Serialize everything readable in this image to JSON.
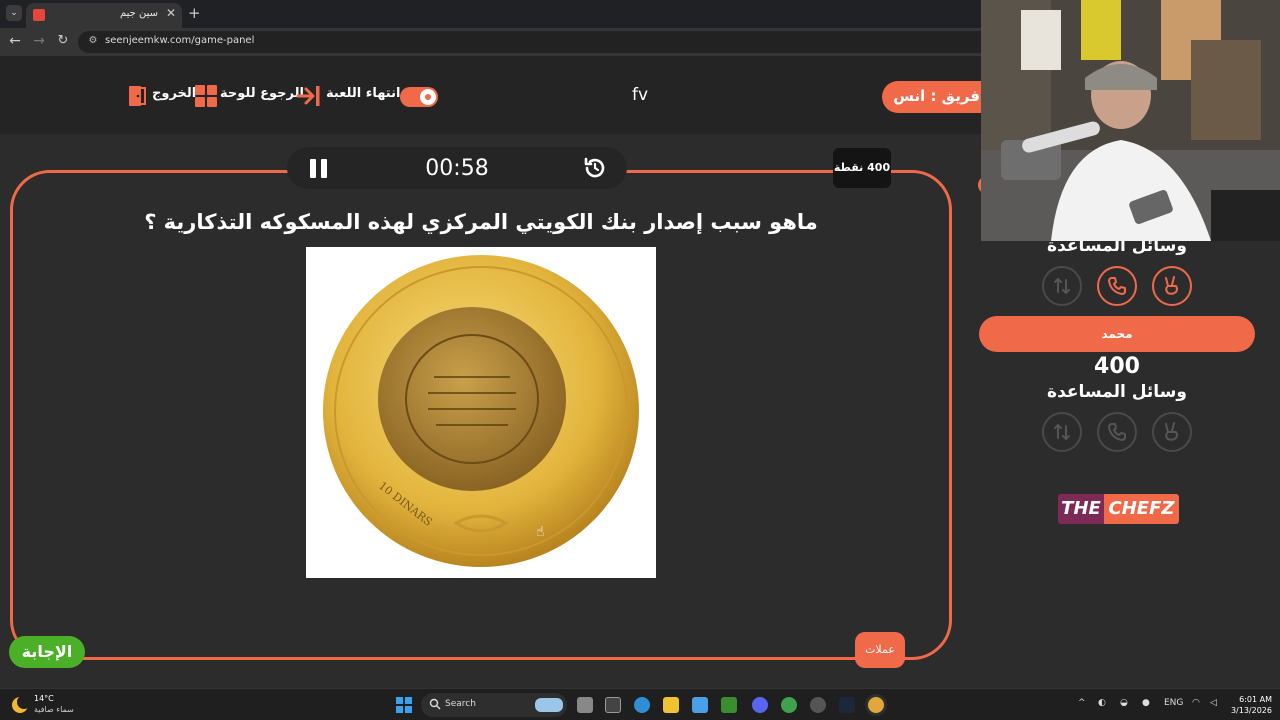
{
  "browser": {
    "tab_title": "سين جيم",
    "tab_close": "✕",
    "new_tab": "+",
    "url": "seenjeemkw.com/game-panel"
  },
  "header": {
    "exit_label": "الخروج",
    "board_label": "الرجوع للوحة",
    "end_game_label": "انتهاء اللعبة",
    "brand": "fv",
    "team_label": "فريق : انس"
  },
  "question_panel": {
    "timer": "00:58",
    "points": "400 نقطة",
    "question": "ماهو سبب إصدار بنك الكويتي المركزي لهذه المسكوكه التذكارية ؟",
    "image_alt": "gold commemorative coin 10 DINARS",
    "coin_text": "10 DINARS",
    "category": "عملات",
    "answer_button": "الإجابة"
  },
  "right_panel": {
    "aids_title_1": "وسائل المساعدة",
    "team_2_name": "محمد",
    "team_2_score": "400",
    "aids_title_2": "وسائل المساعدة",
    "sponsor_the": "THE",
    "sponsor_name": "CHEFZ"
  },
  "taskbar": {
    "temperature": "14°C",
    "weather": "سماء صافية",
    "search_placeholder": "Search",
    "language": "ENG",
    "time": "6:01 AM",
    "date": "3/13/2026"
  },
  "colors": {
    "accent": "#f06a4a",
    "answer_green": "#4caf28",
    "background": "#2c2c2c",
    "header_bg": "#242424",
    "sponsor_purple": "#7e2a57"
  }
}
